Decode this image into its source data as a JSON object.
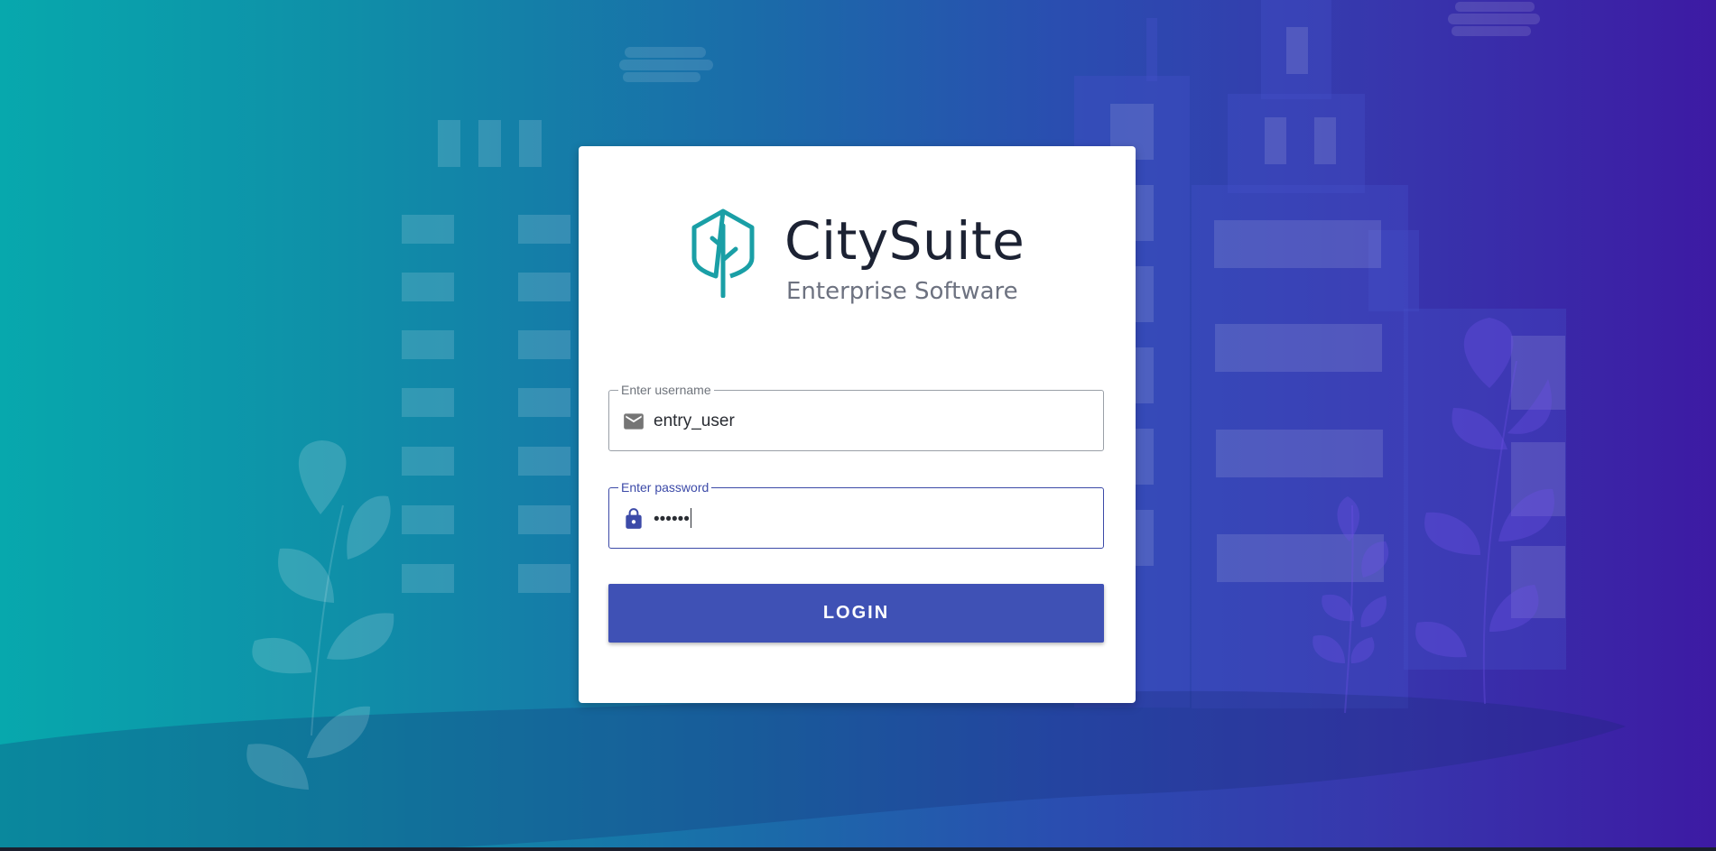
{
  "brand": {
    "name": "CitySuite",
    "tagline": "Enterprise Software",
    "accent_color": "#1a9fa6"
  },
  "form": {
    "username": {
      "label": "Enter username",
      "value": "entry_user",
      "icon": "mail-icon"
    },
    "password": {
      "label": "Enter password",
      "value": "••••••",
      "icon": "lock-icon"
    },
    "login_label": "LOGIN",
    "button_color": "#3f51b5"
  },
  "background": {
    "gradient_start": "#07a8ad",
    "gradient_end": "#3d1aa3",
    "illustration": "city-skyline"
  }
}
